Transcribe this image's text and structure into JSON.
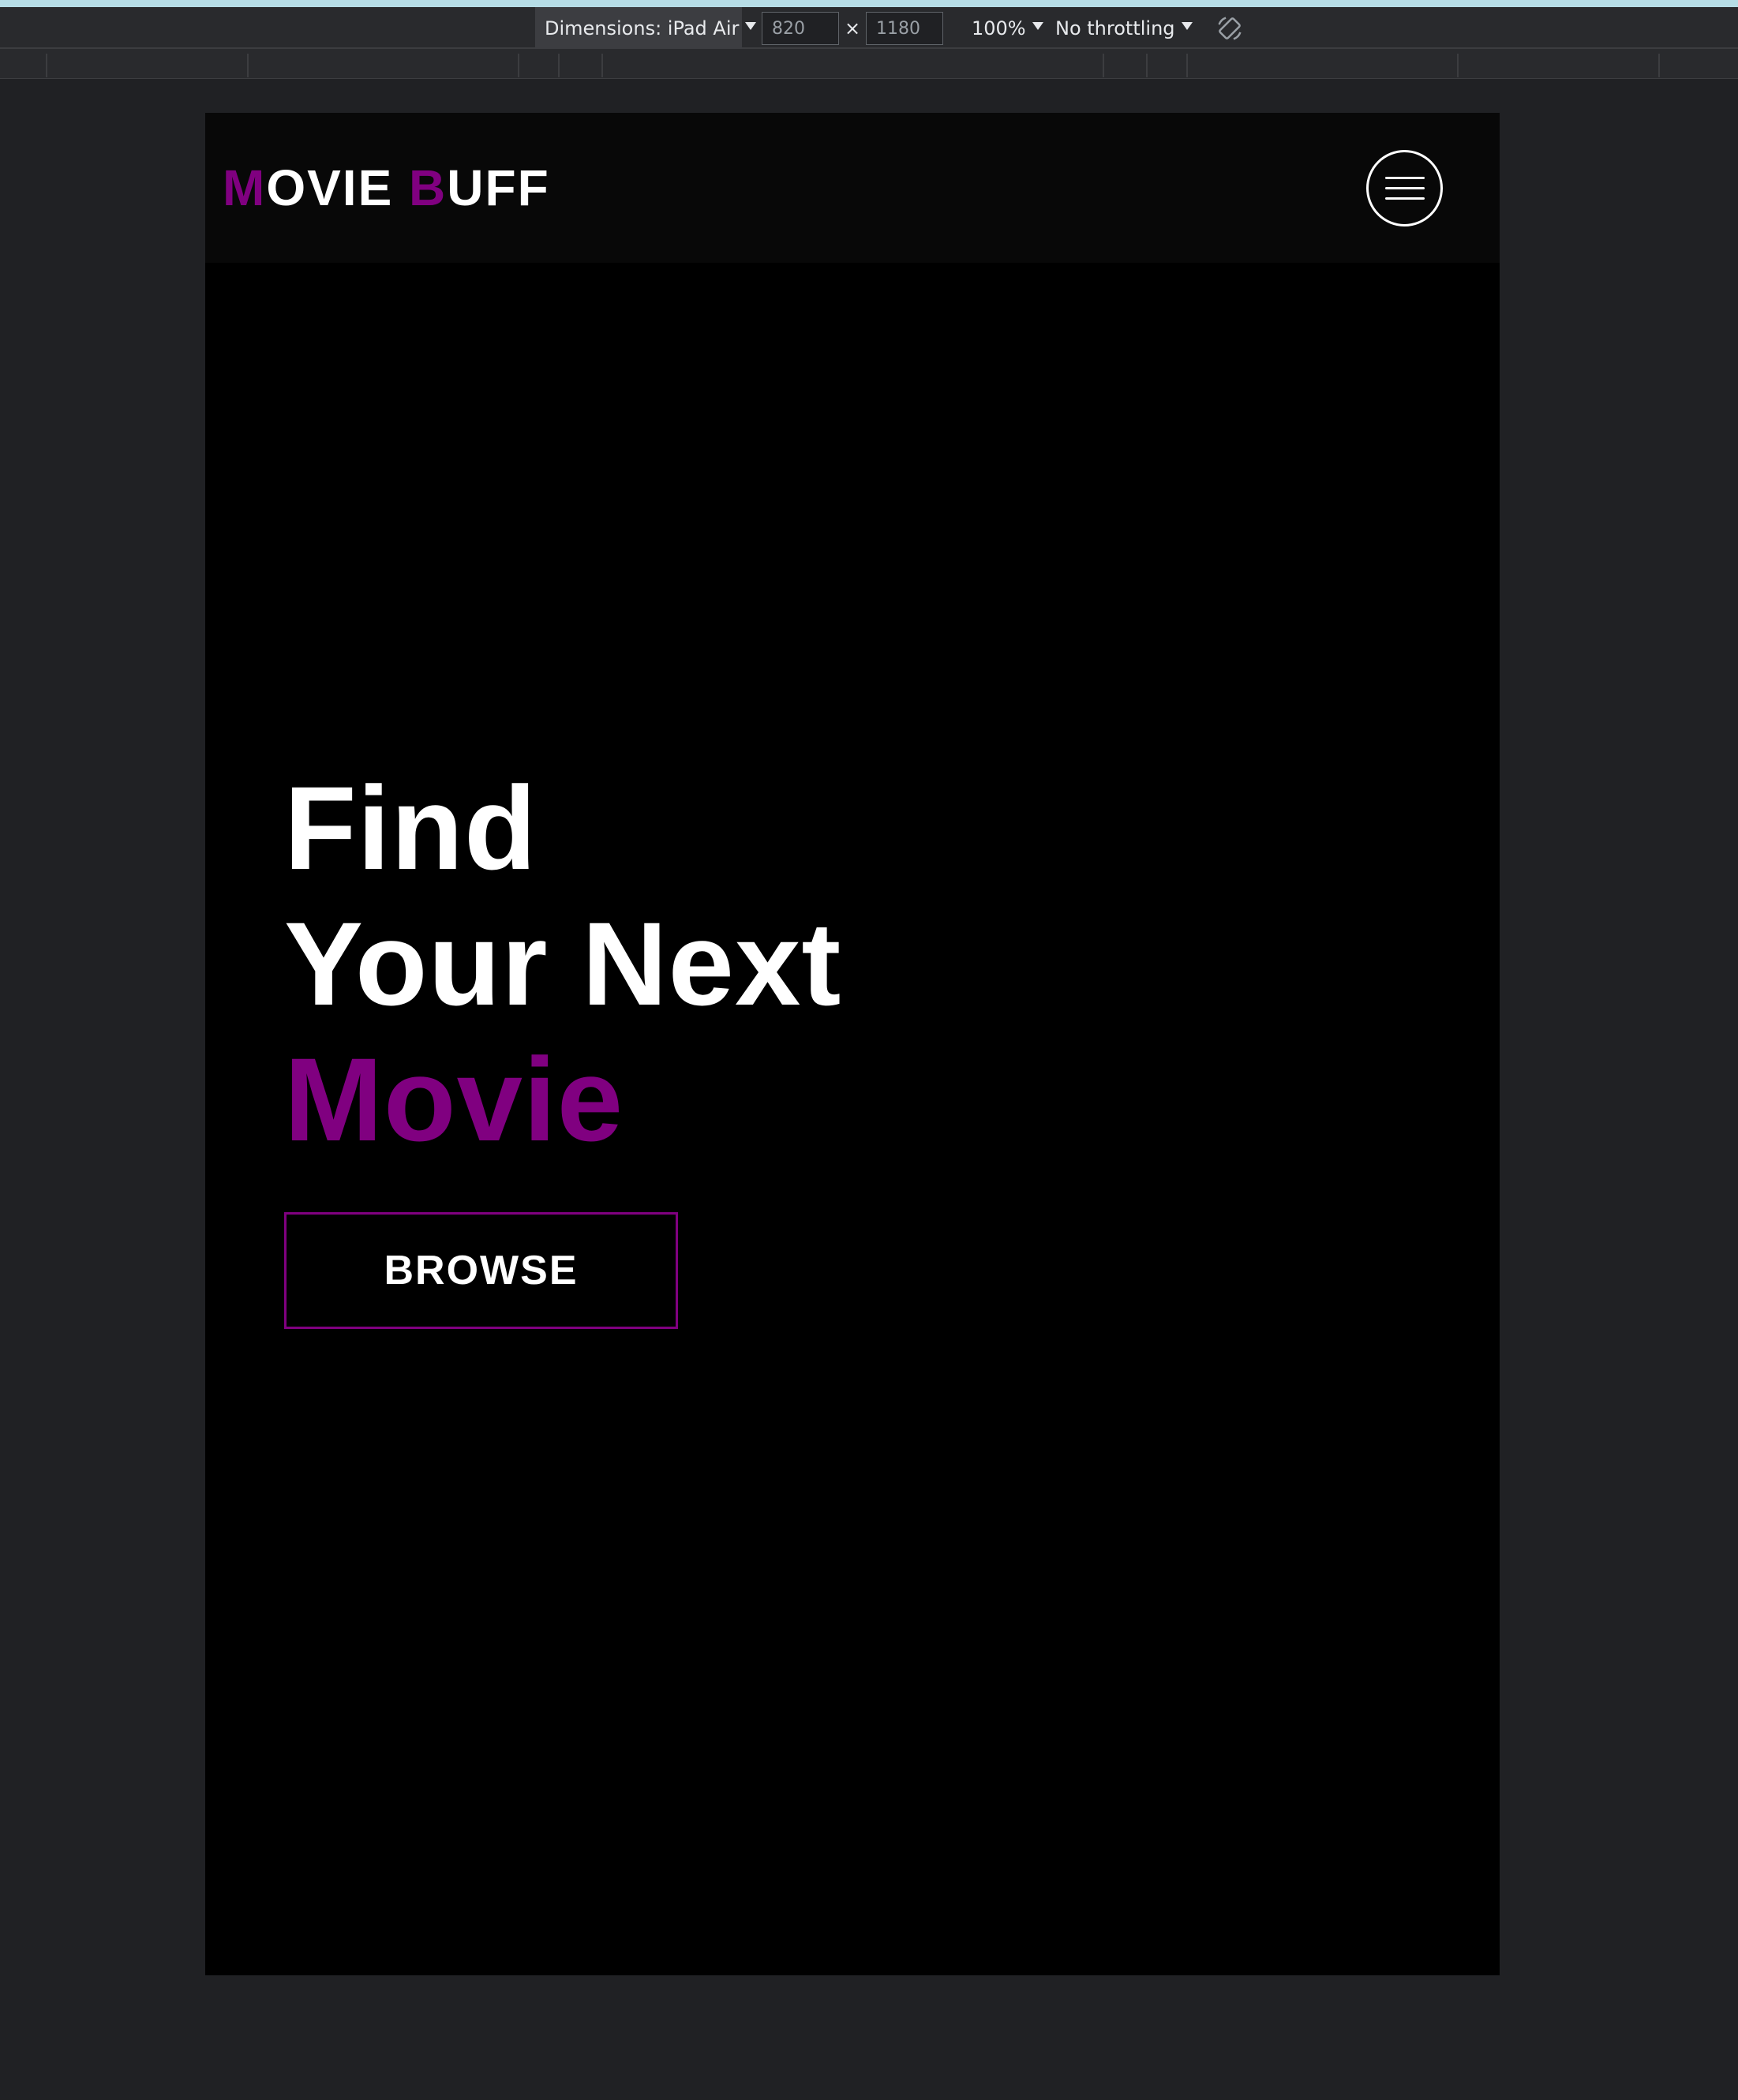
{
  "devtools": {
    "dimensions_label": "Dimensions: iPad Air",
    "width_value": "820",
    "height_value": "1180",
    "times_sign": "×",
    "zoom_label": "100%",
    "throttle_label": "No throttling",
    "rotate_icon": "rotate-icon"
  },
  "site": {
    "logo": {
      "m": "M",
      "ovie": "OVIE ",
      "b": "B",
      "uff": "UFF"
    },
    "menu_icon": "hamburger-menu-icon",
    "hero": {
      "line1": "Find",
      "line2": "Your Next",
      "line3": "Movie"
    },
    "browse_label": "BROWSE"
  },
  "colors": {
    "accent": "#800080",
    "page_bg": "#000000",
    "devtools_bg": "#202124"
  }
}
